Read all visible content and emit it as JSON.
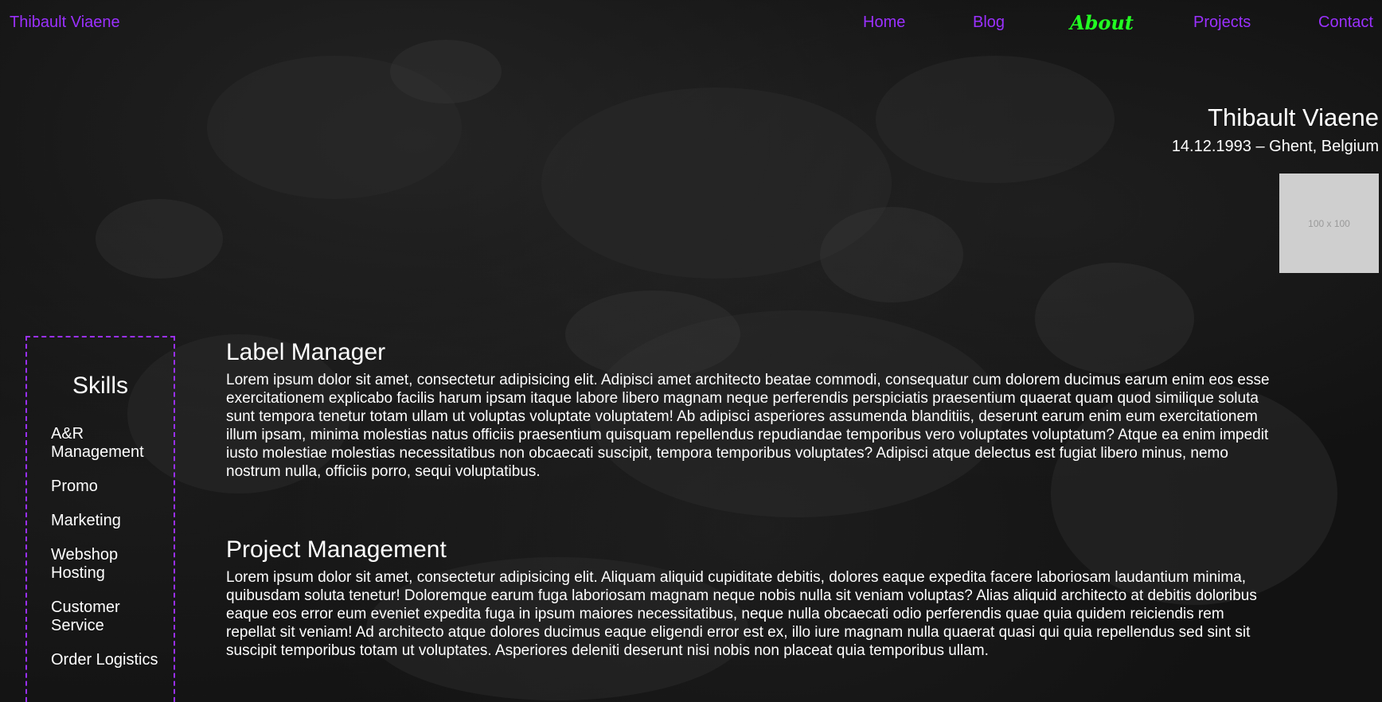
{
  "nav": {
    "brand": "Thibault Viaene",
    "links": [
      "Home",
      "Blog",
      "About",
      "Projects",
      "Contact"
    ],
    "active": "About"
  },
  "profile": {
    "name": "Thibault Viaene",
    "birth": "14.12.1993 – Ghent, Belgium",
    "image_placeholder": "100 x 100"
  },
  "skills": {
    "title": "Skills",
    "items": [
      "A&R Management",
      "Promo",
      "Marketing",
      "Webshop Hosting",
      "Customer Service",
      "Order Logistics"
    ]
  },
  "sections": [
    {
      "title": "Label Manager",
      "body": "Lorem ipsum dolor sit amet, consectetur adipisicing elit. Adipisci amet architecto beatae commodi, consequatur cum dolorem ducimus earum enim eos esse exercitationem explicabo facilis harum ipsam itaque labore libero magnam neque perferendis perspiciatis praesentium quaerat quam quod similique soluta sunt tempora tenetur totam ullam ut voluptas voluptate voluptatem! Ab adipisci asperiores assumenda blanditiis, deserunt earum enim eum exercitationem illum ipsam, minima molestias natus officiis praesentium quisquam repellendus repudiandae temporibus vero voluptates voluptatum? Atque ea enim impedit iusto molestiae molestias necessitatibus non obcaecati suscipit, tempora temporibus voluptates? Adipisci atque delectus est fugiat libero minus, nemo nostrum nulla, officiis porro, sequi voluptatibus."
    },
    {
      "title": "Project Management",
      "body": "Lorem ipsum dolor sit amet, consectetur adipisicing elit. Aliquam aliquid cupiditate debitis, dolores eaque expedita facere laboriosam laudantium minima, quibusdam soluta tenetur! Doloremque earum fuga laboriosam magnam neque nobis nulla sit veniam voluptas? Alias aliquid architecto at debitis doloribus eaque eos error eum eveniet expedita fuga in ipsum maiores necessitatibus, neque nulla obcaecati odio perferendis quae quia quidem reiciendis rem repellat sit veniam! Ad architecto atque dolores ducimus eaque eligendi error est ex, illo iure magnam nulla quaerat quasi qui quia repellendus sed sint sit suscipit temporibus totam ut voluptates. Asperiores deleniti deserunt nisi nobis non placeat quia temporibus ullam."
    }
  ],
  "colors": {
    "accent": "#9b30ff",
    "active": "#22ff22",
    "background": "#121212",
    "text": "#ffffff"
  }
}
